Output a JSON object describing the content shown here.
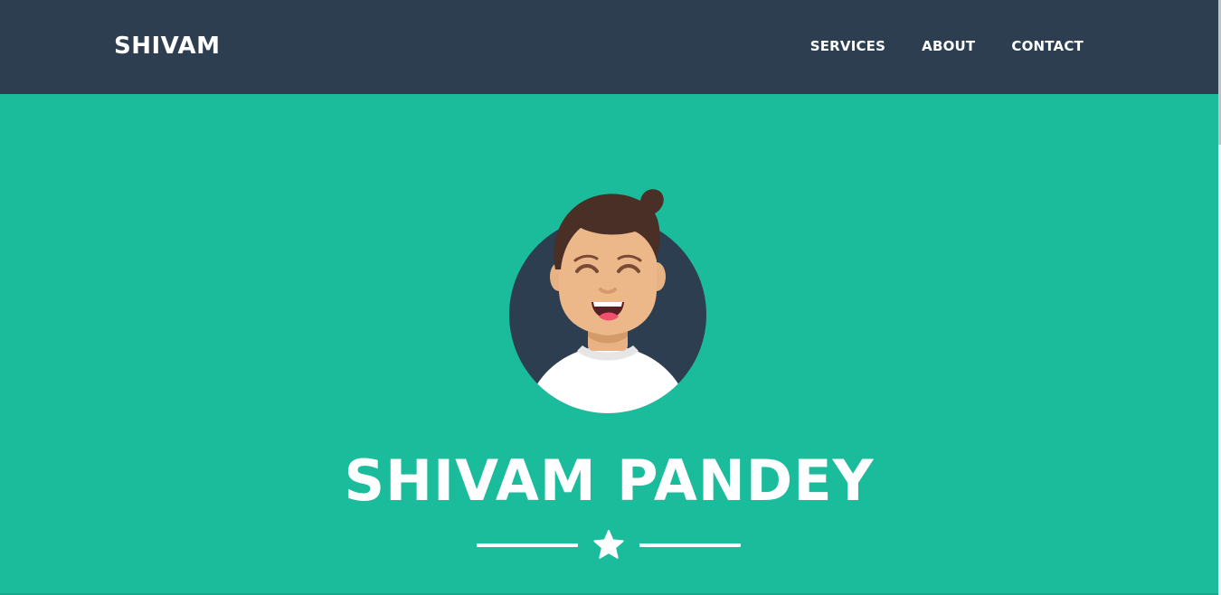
{
  "navbar": {
    "brand": "SHIVAM",
    "links": [
      {
        "label": "SERVICES"
      },
      {
        "label": "ABOUT"
      },
      {
        "label": "CONTACT"
      }
    ]
  },
  "masthead": {
    "heading": "SHIVAM PANDEY",
    "avatar_icon": "avatar-icon",
    "divider_icon": "star-icon"
  },
  "colors": {
    "navbar_bg": "#2c3e50",
    "masthead_bg": "#1abc9c",
    "text": "#ffffff"
  }
}
